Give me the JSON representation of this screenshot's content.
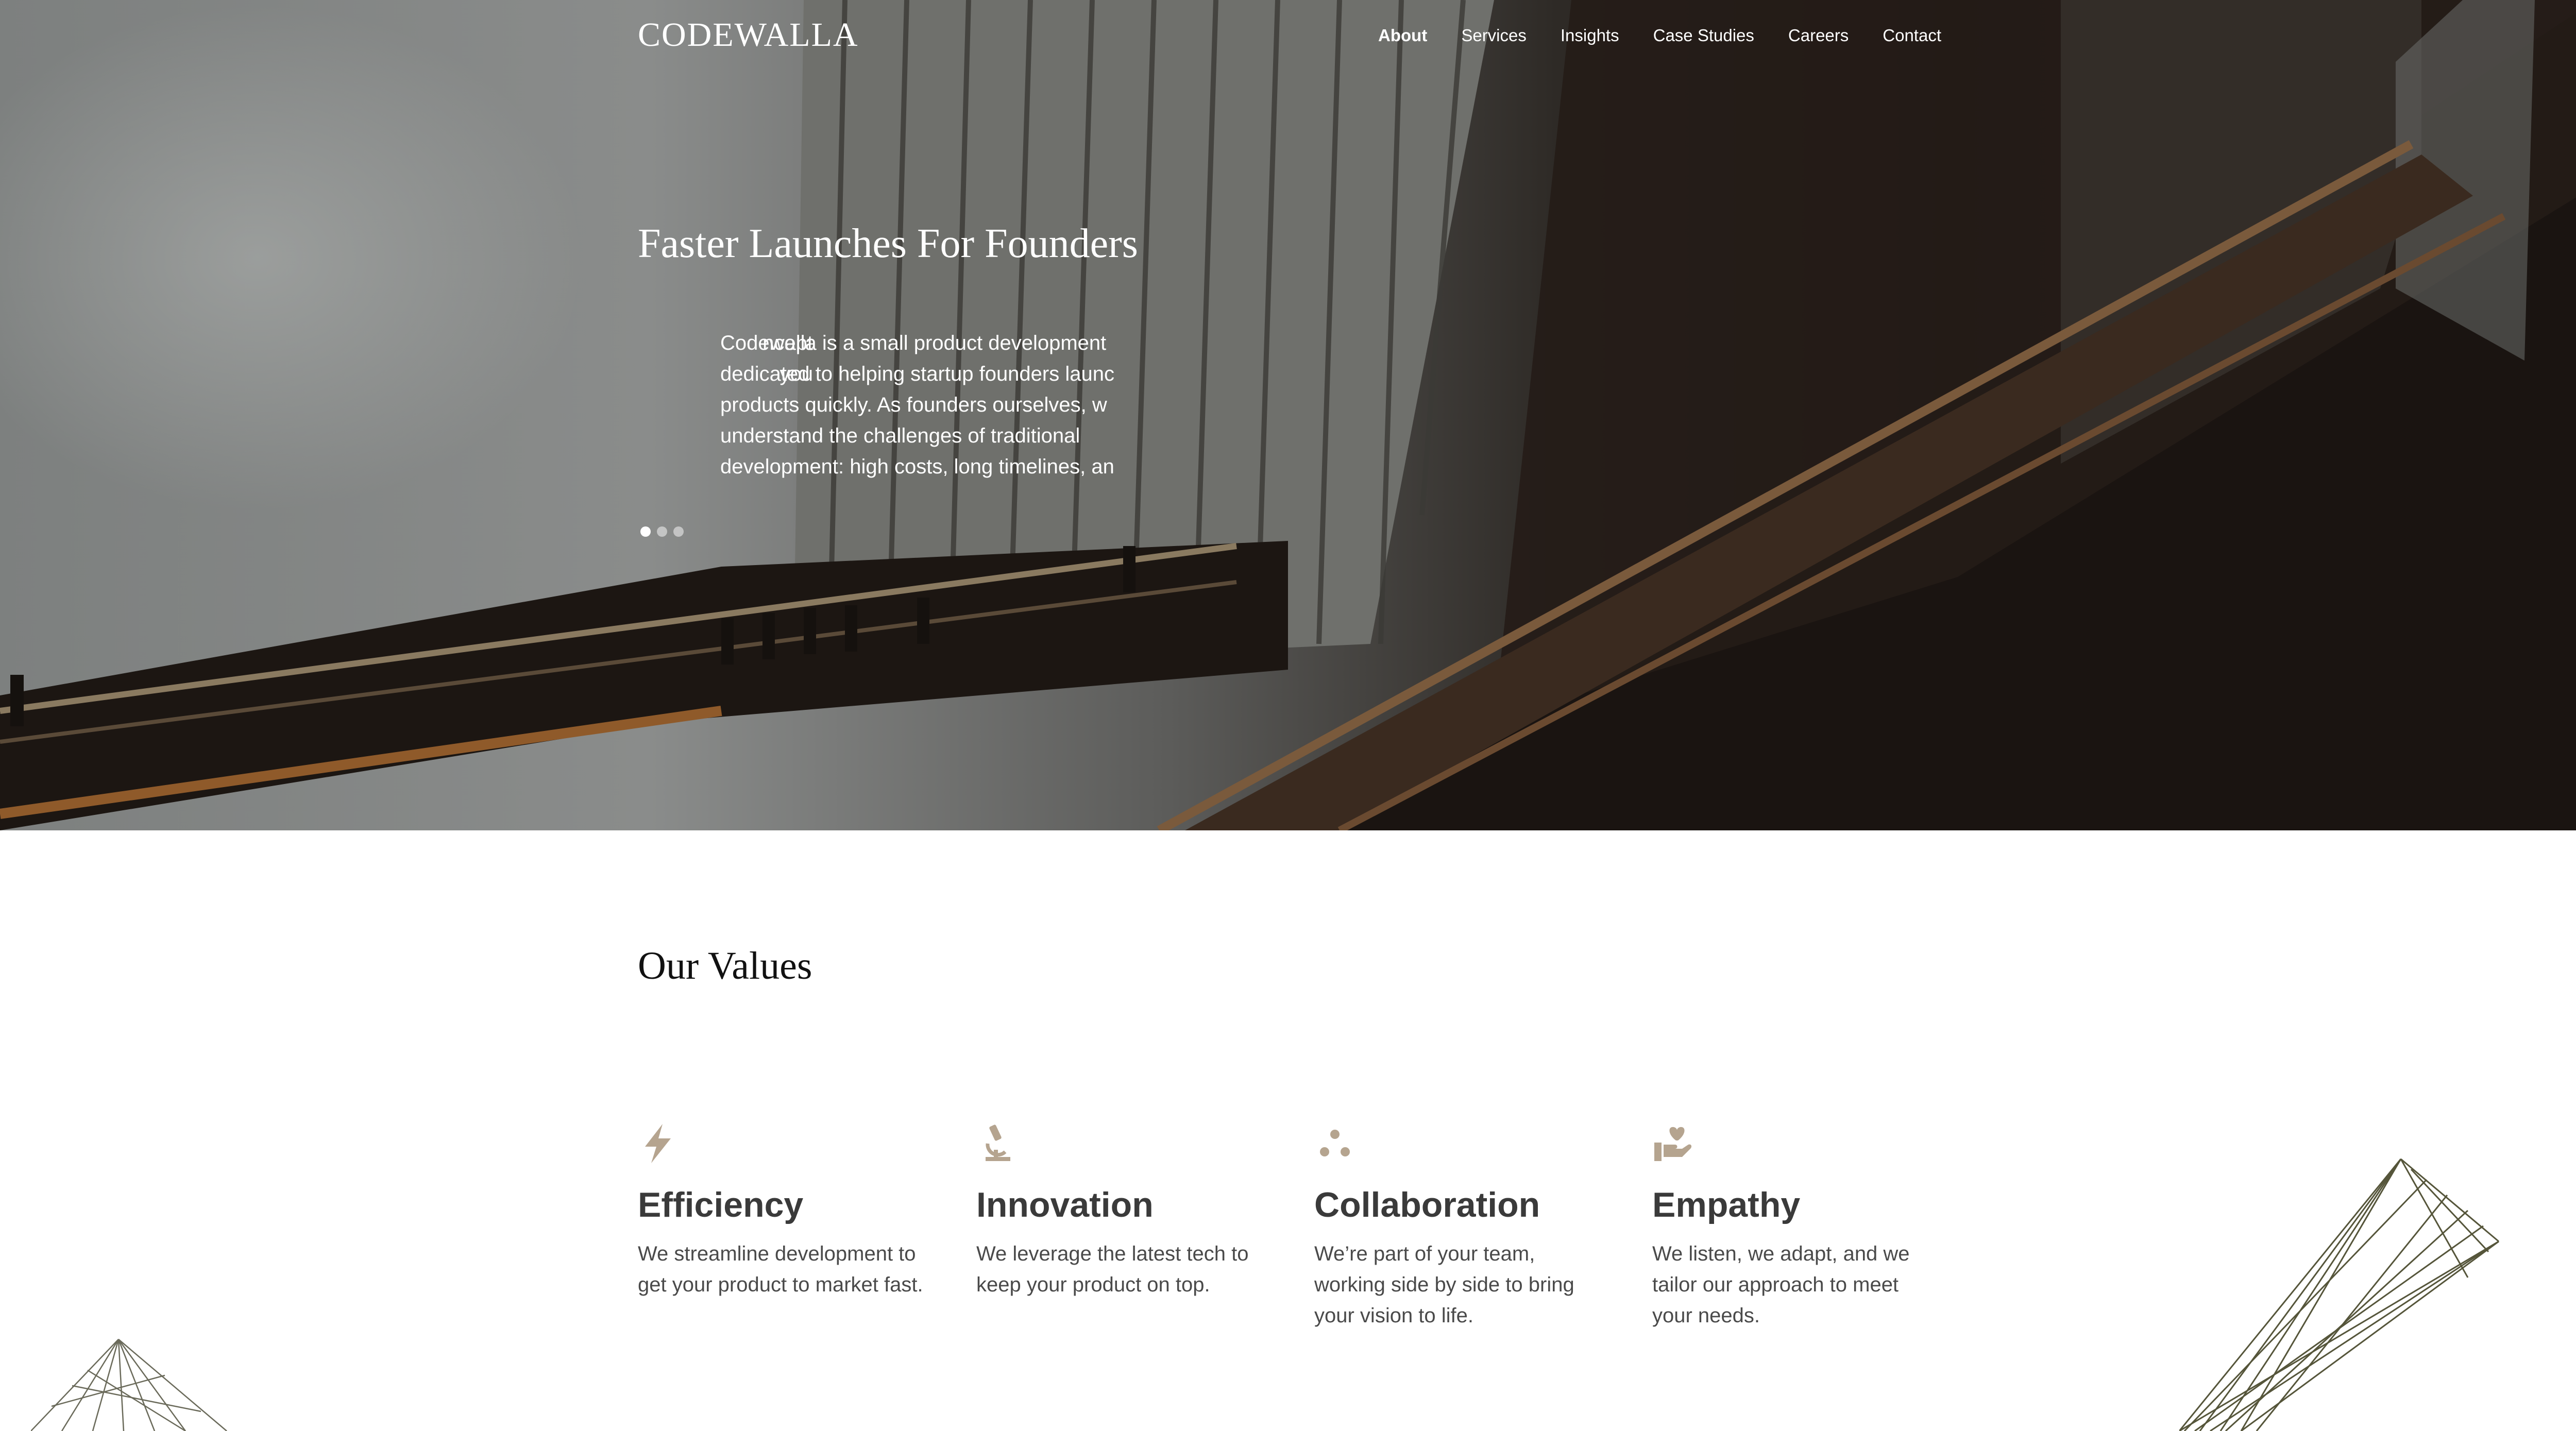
{
  "brand": "CODEWALLA",
  "nav": {
    "about": "About",
    "services": "Services",
    "insights": "Insights",
    "case_studies": "Case Studies",
    "careers": "Careers",
    "contact": "Contact"
  },
  "hero": {
    "title": "Faster Launches For Founders",
    "slide_prev_line1": "ncept",
    "slide_prev_line2": "you",
    "slide_current": "Codewalla is a small product development dedicated to helping startup founders launc products quickly. As founders ourselves, w understand the challenges of traditional development: high costs, long timelines, an",
    "slide_count": 3,
    "active_slide": 1
  },
  "values": {
    "title": "Our Values",
    "items": [
      {
        "icon": "lightning-icon",
        "title": "Efficiency",
        "text": "We streamline development to get your product to market fast."
      },
      {
        "icon": "microscope-icon",
        "title": "Innovation",
        "text": "We leverage the latest tech to keep your product on top."
      },
      {
        "icon": "three-dots-icon",
        "title": "Collaboration",
        "text": "We’re part of your team, working side by side to bring your vision to life."
      },
      {
        "icon": "heart-hand-icon",
        "title": "Empathy",
        "text": "We listen, we adapt, and we tailor our approach to meet your needs."
      }
    ]
  },
  "colors": {
    "icon_tan": "#b5a48f",
    "heading_gray": "#3a3a3a",
    "body_gray": "#4a4a4a",
    "deco_olive": "#5a5a40"
  }
}
